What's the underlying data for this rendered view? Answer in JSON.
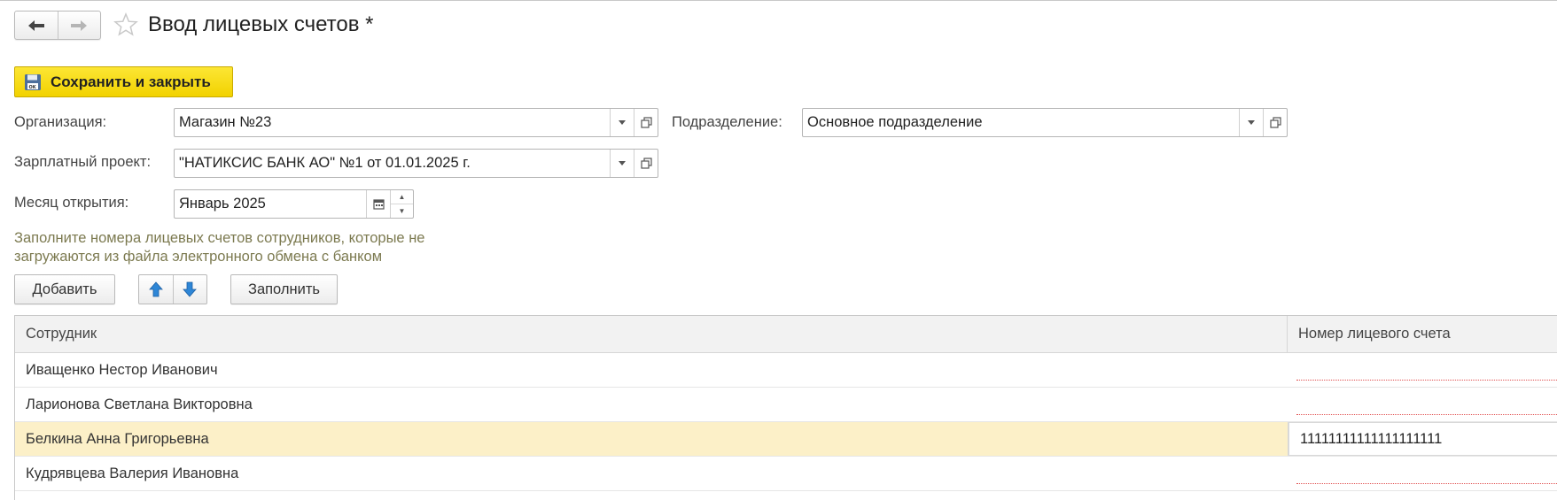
{
  "window": {
    "title": "Ввод лицевых счетов *"
  },
  "toolbar": {
    "save_close_label": "Сохранить и закрыть"
  },
  "form": {
    "organization": {
      "label": "Организация:",
      "value": "Магазин №23"
    },
    "department": {
      "label": "Подразделение:",
      "value": "Основное подразделение"
    },
    "salary_project": {
      "label": "Зарплатный проект:",
      "value": "\"НАТИКСИС БАНК АО\" №1 от 01.01.2025 г."
    },
    "open_month": {
      "label": "Месяц открытия:",
      "value": "Январь 2025"
    },
    "hint": "Заполните номера лицевых счетов сотрудников, которые не загружаются из файла электронного обмена с банком"
  },
  "table_toolbar": {
    "add_label": "Добавить",
    "fill_label": "Заполнить"
  },
  "table": {
    "columns": [
      "Сотрудник",
      "Номер лицевого счета"
    ],
    "rows": [
      {
        "employee": "Иващенко Нестор Иванович",
        "account": ""
      },
      {
        "employee": "Ларионова Светлана Викторовна",
        "account": ""
      },
      {
        "employee": "Белкина Анна Григорьевна",
        "account": "11111111111111111111"
      },
      {
        "employee": "Кудрявцева Валерия Ивановна",
        "account": ""
      }
    ],
    "selected_row": 2
  },
  "colors": {
    "accent_yellow": "#f7dc15",
    "selected_row": "#fcf0c8",
    "hint_text": "#7c7a50",
    "arrow_blue": "#2e86d6"
  }
}
